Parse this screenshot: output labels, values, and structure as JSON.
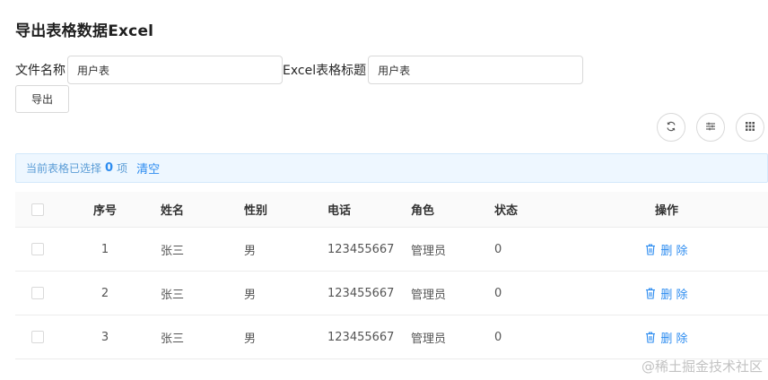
{
  "page": {
    "title": "导出表格数据Excel"
  },
  "form": {
    "file_name_label": "文件名称",
    "file_name_value": "用户表",
    "sheet_title_label": "Excel表格标题",
    "sheet_title_value": "用户表",
    "export_label": "导出"
  },
  "toolbar": {
    "icons": [
      "refresh-icon",
      "column-settings-icon",
      "density-icon"
    ]
  },
  "selection": {
    "prefix": "当前表格已选择",
    "count": "0",
    "suffix": "项",
    "clear_label": "清空"
  },
  "table": {
    "columns": {
      "index": "序号",
      "name": "姓名",
      "gender": "性别",
      "phone": "电话",
      "role": "角色",
      "status": "状态",
      "actions": "操作"
    },
    "rows": [
      {
        "index": "1",
        "name": "张三",
        "gender": "男",
        "phone": "123455667",
        "role": "管理员",
        "status": "0",
        "delete_label": "删 除"
      },
      {
        "index": "2",
        "name": "张三",
        "gender": "男",
        "phone": "123455667",
        "role": "管理员",
        "status": "0",
        "delete_label": "删 除"
      },
      {
        "index": "3",
        "name": "张三",
        "gender": "男",
        "phone": "123455667",
        "role": "管理员",
        "status": "0",
        "delete_label": "删 除"
      }
    ]
  },
  "watermark": "@稀土掘金技术社区",
  "colors": {
    "accent": "#2d8cf0",
    "alert_bg": "#eef7ff"
  }
}
